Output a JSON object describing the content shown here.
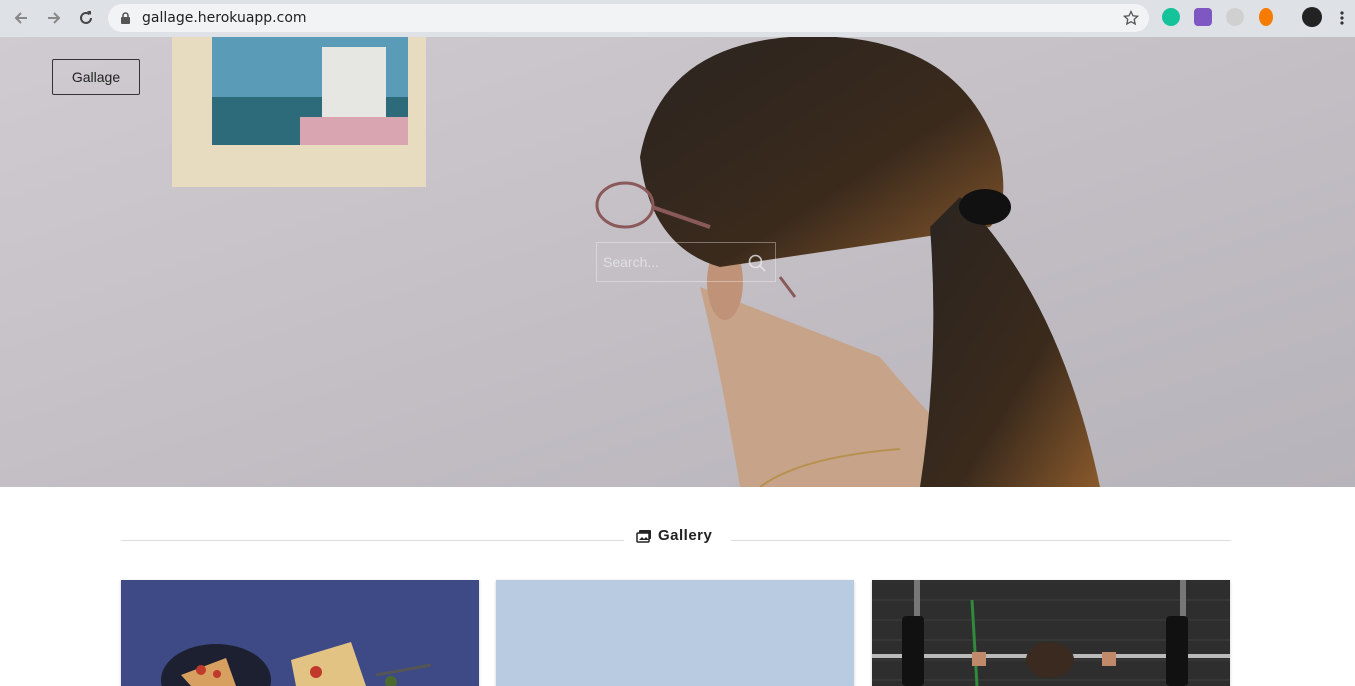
{
  "browser": {
    "url": "gallage.herokuapp.com"
  },
  "hero": {
    "brand_label": "Gallage",
    "search_placeholder": "Search..."
  },
  "gallery": {
    "title": "Gallery",
    "cards": [
      {
        "name": "food-photo"
      },
      {
        "name": "sky-photo"
      },
      {
        "name": "fitness-photo"
      }
    ]
  }
}
